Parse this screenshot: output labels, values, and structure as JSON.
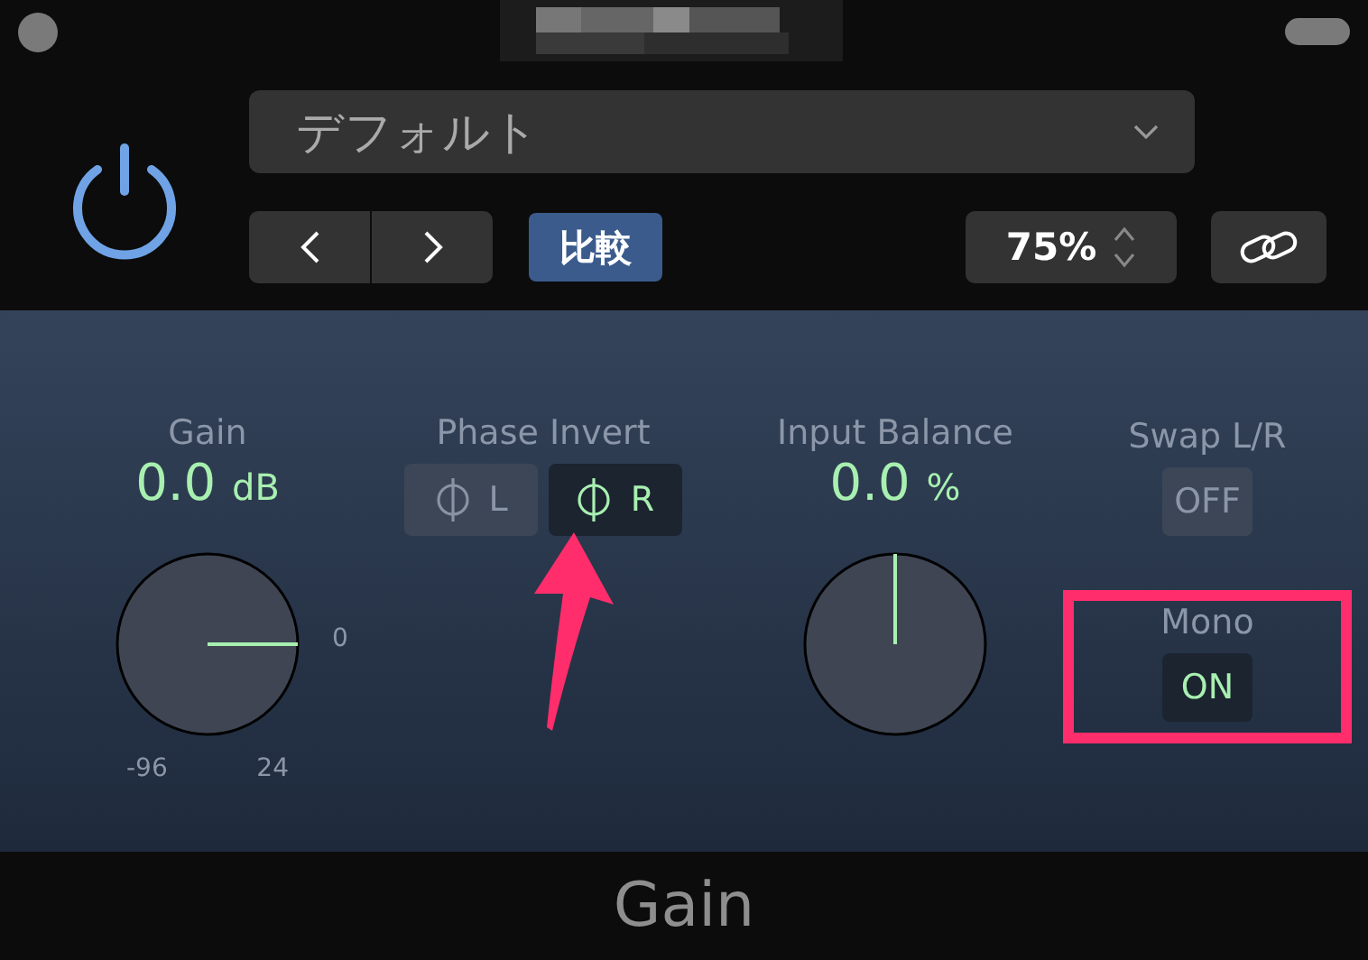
{
  "header": {
    "preset": "デフォルト",
    "compare_button": "比較",
    "zoom": "75%"
  },
  "controls": [
    {
      "kind": "knob",
      "label": "Gain",
      "value": "0.0",
      "unit": "dB",
      "min_label": "-96",
      "max_label": "24",
      "mark_label": "0"
    },
    {
      "kind": "toggle_pair",
      "label": "Phase Invert",
      "buttons": [
        {
          "text": "L",
          "on": false,
          "arrow": false
        },
        {
          "text": "R",
          "on": true,
          "arrow": true
        }
      ]
    },
    {
      "kind": "knob",
      "label": "Input Balance",
      "value": "0.0",
      "unit": "%"
    },
    {
      "kind": "toggle_stack",
      "items": [
        {
          "label": "Swap L/R",
          "text": "OFF",
          "on": false,
          "highlighted": false
        },
        {
          "label": "Mono",
          "text": "ON",
          "on": true,
          "highlighted": true
        }
      ]
    }
  ],
  "footer": {
    "title": "Gain"
  }
}
